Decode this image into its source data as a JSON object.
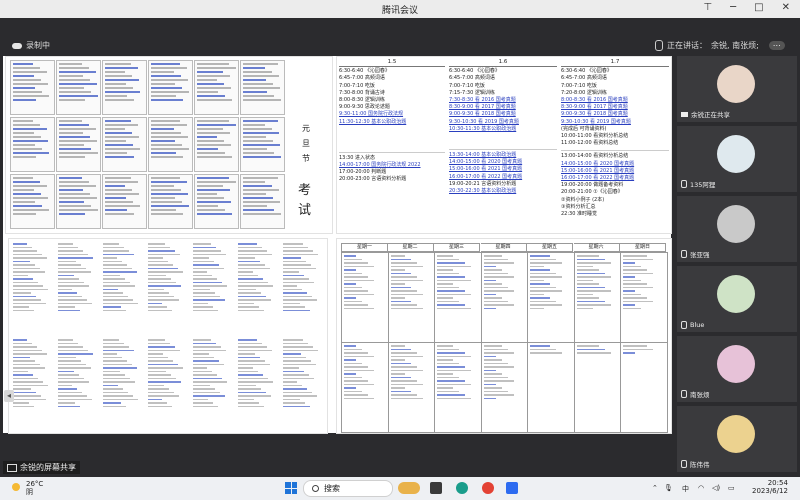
{
  "window": {
    "title": "腾讯会议"
  },
  "meeting": {
    "recording_label": "录制中",
    "speaking_prefix": "正在讲话：",
    "speaking_names": "余锐, 南张烦;",
    "share_label": "余锐的屏幕共享"
  },
  "participants": [
    {
      "name": "余锐正在共享",
      "avatar_color": "#e9d6c8"
    },
    {
      "name": "135阿狸",
      "avatar_color": "#dfe9ee"
    },
    {
      "name": "张亚强",
      "avatar_color": "#c9c9c9"
    },
    {
      "name": "Blue",
      "avatar_color": "#cfe3c6"
    },
    {
      "name": "南张烦",
      "avatar_color": "#e7c2d8"
    },
    {
      "name": "陈伟伟",
      "avatar_color": "#ecd28f"
    }
  ],
  "document": {
    "holiday_chars": [
      "元",
      "旦",
      "节"
    ],
    "exam_chars": [
      "考",
      "试"
    ],
    "col_headers": [
      "1.5",
      "1.6",
      "1.7"
    ],
    "week_headers": [
      "星期一",
      "星期二",
      "星期三",
      "星期四",
      "星期五",
      "星期六",
      "星期日"
    ],
    "col1_am": [
      "6:30-6:40 《沁园春》",
      "6:45-7:00 高频词语",
      "7:00-7:10 吃饭",
      "7:30-8:00 背诵古诗",
      "8:00-8:30 逻辑训练",
      "9:00-9:30 思政论述题",
      "9:30-11:00 国务院行政法规",
      "11:30-12:30 基本公职政治题"
    ],
    "col1_pm": [
      "13:30 进入状态",
      "14:00-17:00 国务院行政法规 2022",
      "17:00-20:00 判断题",
      "20:00-23:00 言语资料分析题"
    ],
    "col2_am": [
      "6:30-6:40 《沁园春》",
      "6:45-7:00 高频词语",
      "7:00-7:10 吃饭",
      "7:15-7:30 逻辑训练",
      "7:30-8:30 看 2016 国考真题",
      "8:30-9:00 看 2017 国考真题",
      "9:00-9:30 看 2018 国考真题",
      "9:30-10:30 看 2019 国考真题",
      "10:30-11:30 基本公职政治题"
    ],
    "col2_pm": [
      "13:30-14:00 基本公职政治题",
      "14:00-15:00 看 2020 国考真题",
      "15:00-16:00 看 2021 国考真题",
      "16:00-17:00 看 2022 国考真题",
      "19:00-20:21 言语资料分析题",
      "20:30-22:30 基本公职政治题"
    ],
    "col3_am": [
      "6:30-6:40 《沁园春》",
      "6:45-7:00 高频词语",
      "7:00-7:10 吃饭",
      "7:20-8:00 逻辑训练",
      "8:00-8:30 看 2016 国考真题",
      "8:30-9:00 看 2017 国考真题",
      "9:00-9:30 看 2018 国考真题",
      "9:30-10:30 看 2019 国考真题",
      "(完成后 可背诵资料)",
      "10:00-11:00 看资料分析总结",
      "11:00-12:00 看资料总结"
    ],
    "col3_pm": [
      "13:00-14:00 看资料分析总结",
      "14:00-15:00 看 2020 国考真题",
      "15:00-16:00 看 2021 国考真题",
      "16:00-17:00 看 2022 国考真题",
      "19:00-20:00 做题备考资料",
      "20:00-21:00 ①《沁园春》",
      "②资料小例子 (2本)",
      "③资料分析汇总",
      "22:30 准时睡觉"
    ]
  }
}
